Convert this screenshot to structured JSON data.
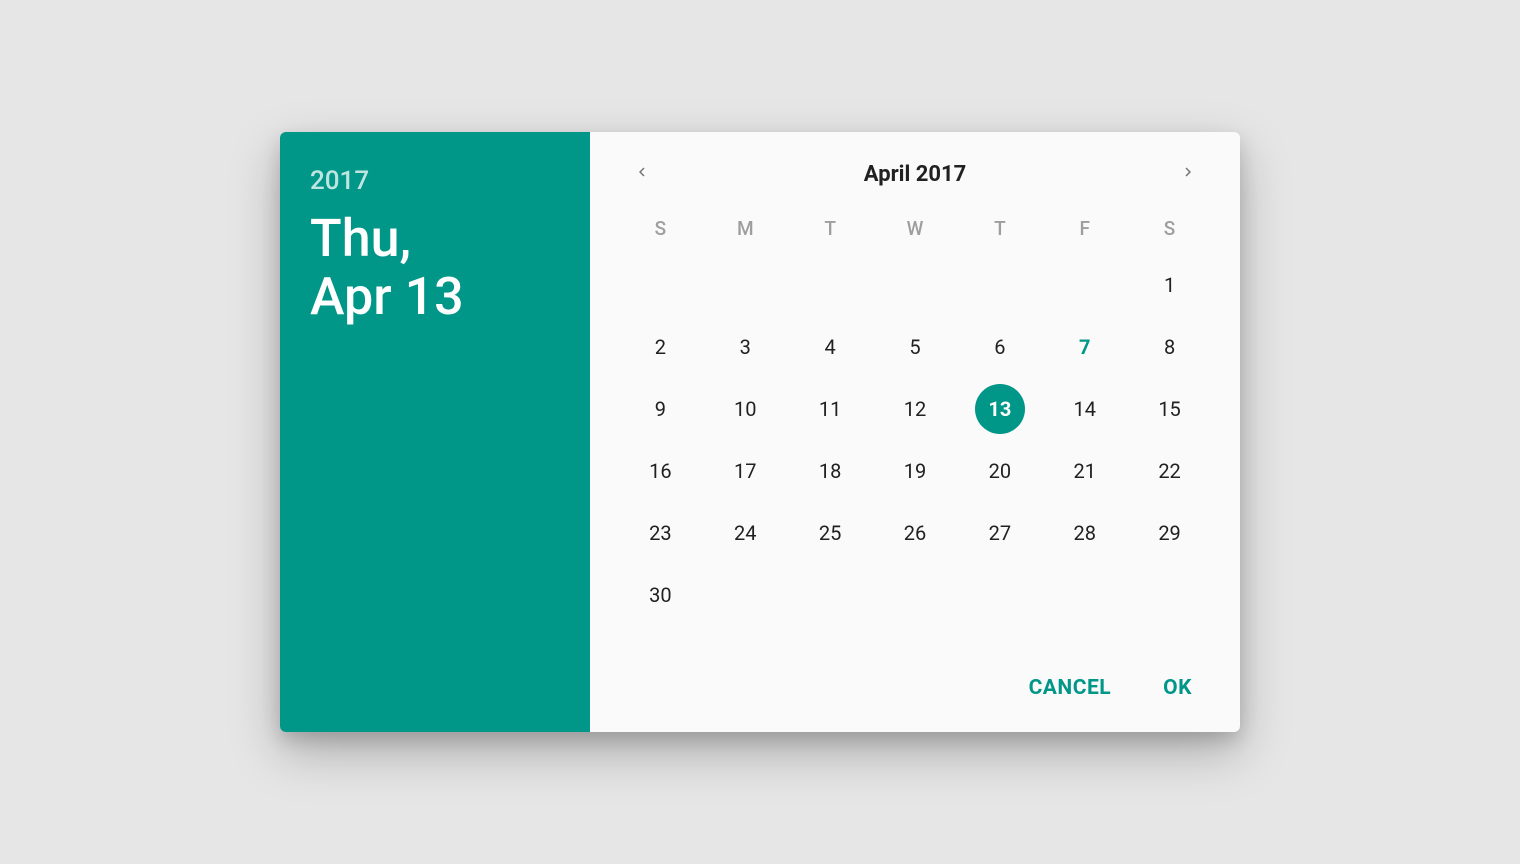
{
  "accent": "#009688",
  "header": {
    "year": "2017",
    "date": "Thu,\nApr 13"
  },
  "calendar": {
    "title": "April 2017",
    "dow": [
      "S",
      "M",
      "T",
      "W",
      "T",
      "F",
      "S"
    ],
    "leading_blanks": 6,
    "days_in_month": 30,
    "today": 7,
    "selected": 13
  },
  "actions": {
    "cancel": "Cancel",
    "ok": "OK"
  }
}
